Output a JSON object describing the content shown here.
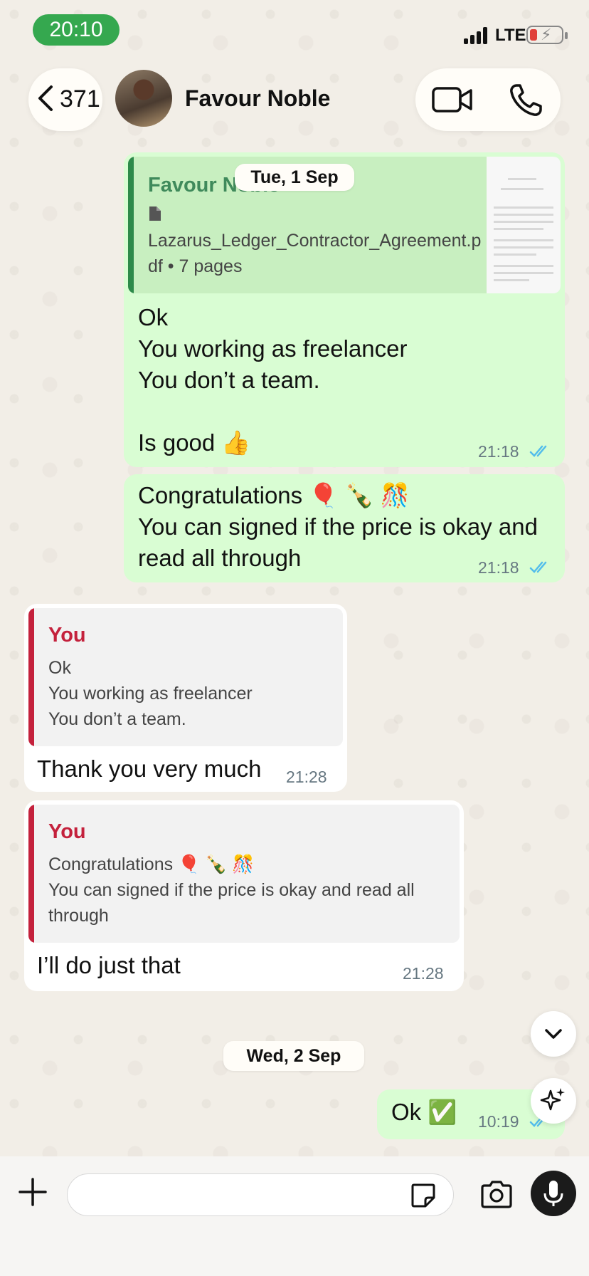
{
  "status_bar": {
    "time": "20:10",
    "network": "LTE"
  },
  "header": {
    "back_count": "371",
    "contact_name": "Favour Noble"
  },
  "messages": {
    "m1": {
      "doc_sender": "Favour Noble",
      "doc_name": "Lazarus_Ledger_Contractor_Agreement.pdf • 7 pages",
      "text": "Ok\nYou working as freelancer\nYou don’t a team.\n\nIs good 👍",
      "time": "21:18"
    },
    "m2": {
      "text": "Congratulations 🎈 🍾 🎊\nYou can signed if the price is okay and\nread all through",
      "time": "21:18"
    },
    "m3": {
      "quote_author": "You",
      "quote_text": "Ok\nYou working as freelancer\nYou don’t a team.",
      "text": "Thank you very much",
      "time": "21:28"
    },
    "m4": {
      "quote_author": "You",
      "quote_text": "Congratulations 🎈 🍾 🎊\nYou can signed if the price is okay and read all\nthrough",
      "text": "I’ll do just that",
      "time": "21:28"
    },
    "m5": {
      "text": "Ok ✅",
      "time": "10:19"
    }
  },
  "date_separators": {
    "first": "Tue, 1 Sep",
    "second": "Wed, 2 Sep"
  },
  "composer": {
    "placeholder": ""
  },
  "colors": {
    "outgoing_bubble": "#d9fdd3",
    "incoming_bubble": "#ffffff",
    "time_pill": "#35a84f",
    "read_ticks": "#53bdeb",
    "quote_accent": "#c4213c",
    "doc_accent": "#2d8a4a"
  },
  "icons": {
    "back": "chevron-left-icon",
    "video": "video-camera-icon",
    "phone": "phone-icon",
    "scroll_down": "chevron-down-icon",
    "ai": "sparkle-icon",
    "attach": "plus-icon",
    "sticker": "sticker-icon",
    "camera": "camera-icon",
    "mic": "microphone-icon"
  }
}
